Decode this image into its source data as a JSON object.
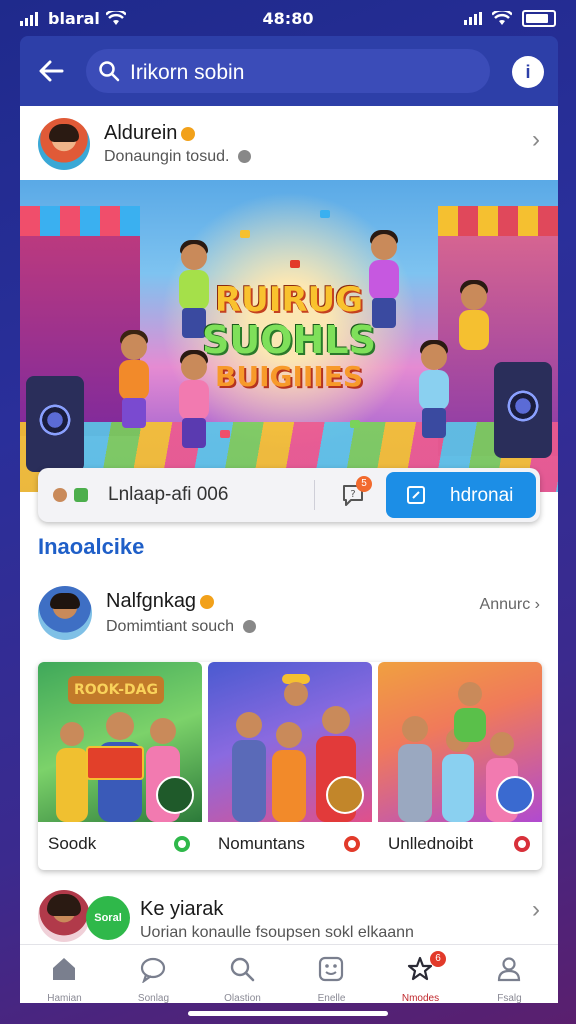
{
  "status_bar": {
    "carrier": "blaral",
    "time": "48:80"
  },
  "header": {
    "search_text": "Irikorn sobin",
    "avatar_initial": "i"
  },
  "post": {
    "author_name": "Aldurein",
    "author_subtitle": "Donaungin tosud.",
    "hero_title_lines": [
      "RUIRUG",
      "SUOHLS",
      "BUIGIIIES"
    ],
    "action_bar": {
      "text": "Lnlaap-afi  006",
      "notification_count": "5",
      "button_label": "hdronai"
    }
  },
  "section": {
    "title": "Inaoalcike"
  },
  "post2": {
    "author_name": "Nalfgnkag",
    "author_subtitle": "Domimtiant souch",
    "meta_right": "Annurc",
    "tiles": [
      {
        "label": "Soodk",
        "dot_color": "#2fb84a",
        "banner": "ROOK-DAG"
      },
      {
        "label": "Nomuntans",
        "dot_color": "#e23a2a"
      },
      {
        "label": "Unllednoibt",
        "dot_color": "#d8303a"
      }
    ]
  },
  "post3": {
    "author_name": "Ke yiarak",
    "author_subtitle": "Uorian konaulle fsoupsen sokl elkaann",
    "badge_text": "Soral"
  },
  "tab_bar": {
    "tabs": [
      {
        "label": "Hamian",
        "icon": "home-icon"
      },
      {
        "label": "Sonlag",
        "icon": "chat-bubble-icon"
      },
      {
        "label": "Olastion",
        "icon": "search-icon"
      },
      {
        "label": "Enelle",
        "icon": "smiley-box-icon"
      },
      {
        "label": "Nmodes",
        "icon": "star-icon",
        "badge": "6",
        "active": true
      },
      {
        "label": "Fsalg",
        "icon": "person-icon"
      }
    ]
  },
  "colors": {
    "accent": "#1c8ee6",
    "header": "#2d3fa8",
    "section_title": "#1f5fc8",
    "active_tab": "#c0282d"
  }
}
